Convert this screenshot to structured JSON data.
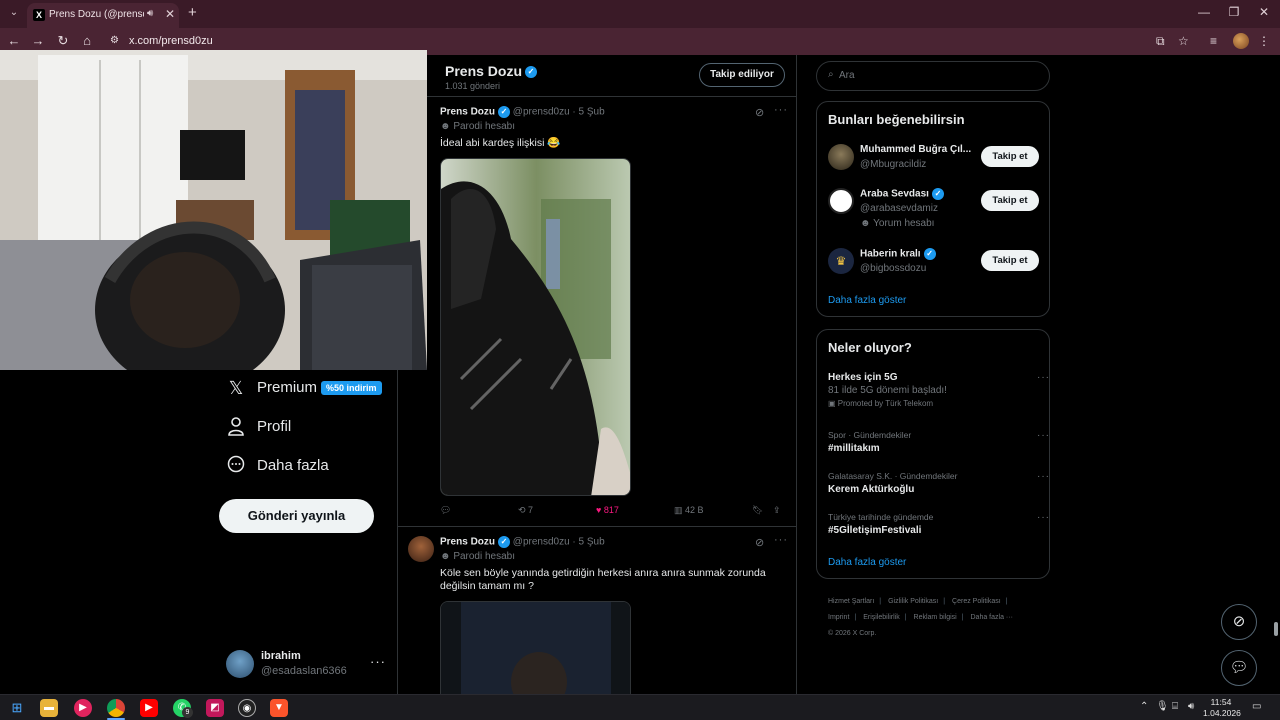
{
  "browser": {
    "tab_title": "Prens Dozu (@prensd0zu) /",
    "tab_favicon": "X",
    "url": "x.com/prensd0zu",
    "window_controls": {
      "minimize": "—",
      "restore": "❐",
      "close": "✕"
    }
  },
  "nav": {
    "premium_label": "Premium",
    "premium_badge": "%50 indirim",
    "profile_label": "Profil",
    "more_label": "Daha fazla",
    "post_button": "Gönderi yayınla",
    "account_name": "ibrahim",
    "account_handle": "@esadaslan6366"
  },
  "profile": {
    "name": "Prens Dozu",
    "post_count": "1.031 gönderi",
    "follow_button": "Takip ediliyor"
  },
  "tweets": [
    {
      "name": "Prens Dozu",
      "handle_date": "@prensd0zu · 5 Şub",
      "parody": "Parodi hesabı",
      "text": "İdeal abi kardeş ilişkisi 😂",
      "reposts": "7",
      "likes": "817",
      "views": "42 B"
    },
    {
      "name": "Prens Dozu",
      "handle_date": "@prensd0zu · 5 Şub",
      "parody": "Parodi hesabı",
      "text": "Köle sen böyle yanında getirdiğin herkesi anıra anıra sunmak zorunda değilsin tamam mı ?"
    }
  ],
  "sidebar": {
    "search_placeholder": "Ara",
    "who_to_follow": {
      "title": "Bunları beğenebilirsin",
      "users": [
        {
          "name": "Muhammed Buğra Çıl...",
          "handle": "@Mbugracildiz",
          "button": "Takip et"
        },
        {
          "name": "Araba Sevdası",
          "handle": "@arabasevdamiz",
          "extra": "Yorum hesabı",
          "button": "Takip et"
        },
        {
          "name": "Haberin kralı",
          "handle": "@bigbossdozu",
          "button": "Takip et"
        }
      ],
      "show_more": "Daha fazla göster"
    },
    "trends": {
      "title": "Neler oluyor?",
      "items": [
        {
          "category": "",
          "name": "Herkes için 5G",
          "subtitle": "81 ilde 5G dönemi başladı!",
          "promo": "Promoted by Türk Telekom"
        },
        {
          "category": "Spor · Gündemdekiler",
          "name": "#millitakım"
        },
        {
          "category": "Galatasaray S.K. · Gündemdekiler",
          "name": "Kerem Aktürkoğlu"
        },
        {
          "category": "Türkiye tarihinde gündemde",
          "name": "#5GİletişimFestivali"
        }
      ],
      "show_more": "Daha fazla göster"
    },
    "footer": {
      "links": [
        "Hizmet Şartları",
        "Gizlilik Politikası",
        "Çerez Politikası",
        "Imprint",
        "Erişilebilirlik",
        "Reklam bilgisi",
        "Daha fazla ···"
      ],
      "copyright": "© 2026 X Corp."
    }
  },
  "taskbar": {
    "time": "11:54",
    "date": "1.04.2026",
    "whatsapp_badge": "9"
  },
  "colors": {
    "accent": "#1d9bf0",
    "like": "#f91880",
    "browser_frame": "#4a2433"
  }
}
